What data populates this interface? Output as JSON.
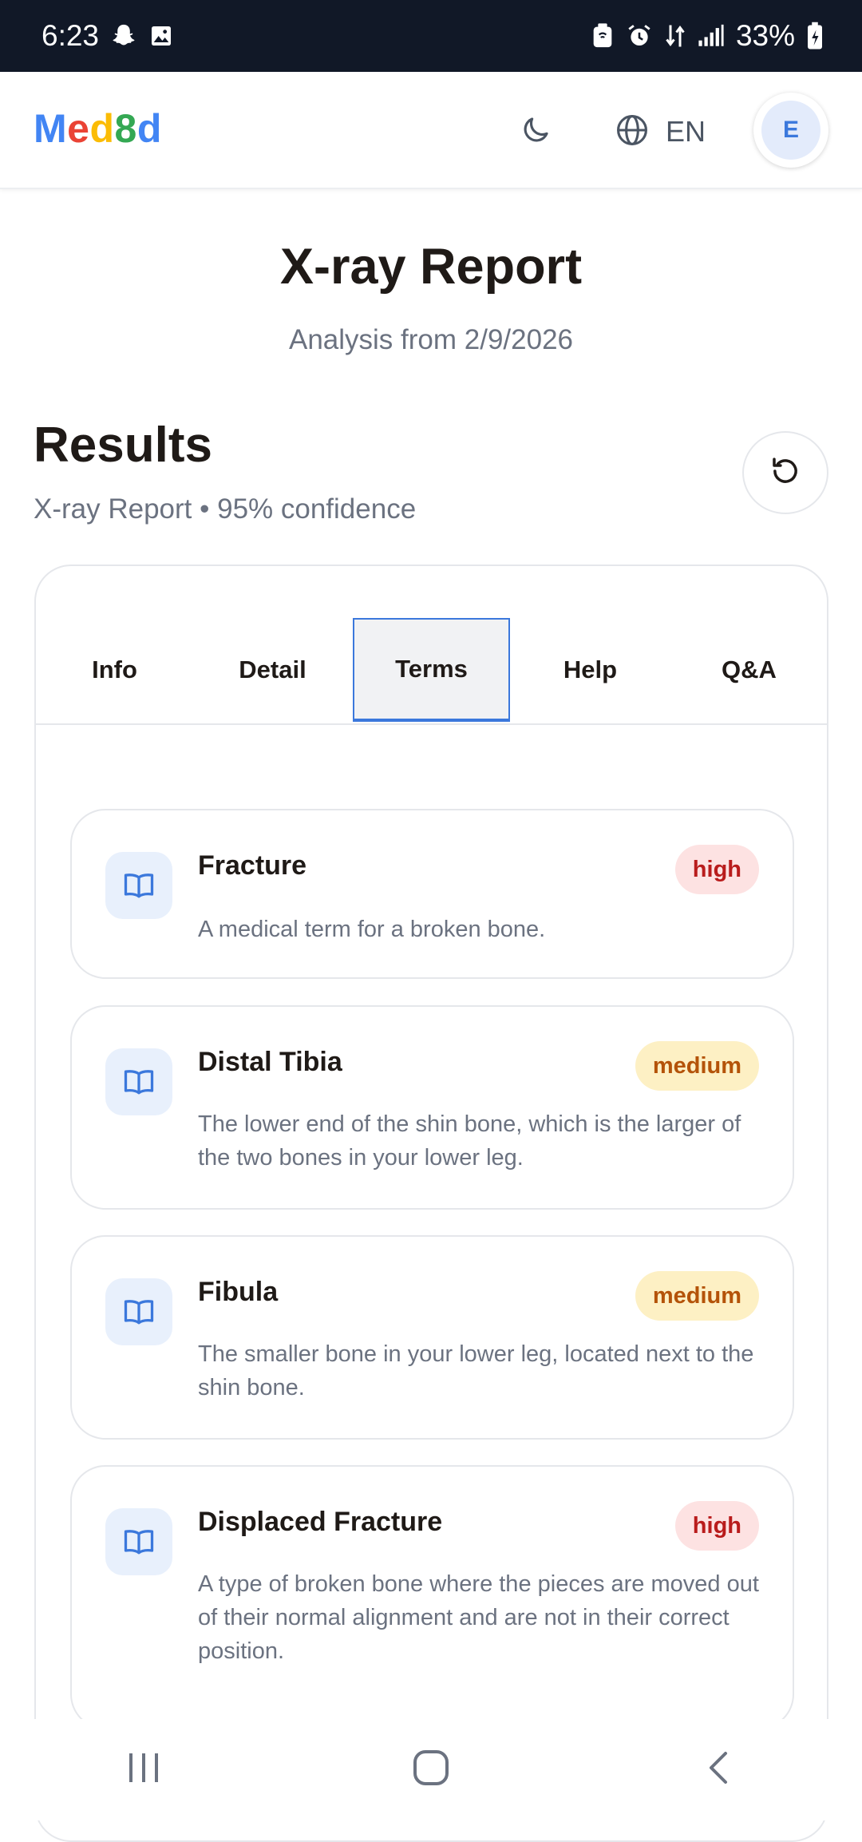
{
  "status_bar": {
    "time": "6:23",
    "battery": "33%",
    "left_icons": [
      "snapchat-icon",
      "gallery-icon"
    ],
    "right_icons": [
      "nfc-icon",
      "alarm-icon",
      "data-arrows-icon",
      "signal-icon",
      "battery-charging-icon"
    ]
  },
  "header": {
    "logo_letters": [
      {
        "char": "M",
        "color": "#4285F4"
      },
      {
        "char": "e",
        "color": "#EA4335"
      },
      {
        "char": "d",
        "color": "#FBBC05"
      },
      {
        "char": "8",
        "color": "#34A853"
      },
      {
        "char": "d",
        "color": "#4285F4"
      }
    ],
    "language": "EN",
    "avatar_initial": "E"
  },
  "page": {
    "title": "X-ray Report",
    "subtitle": "Analysis from 2/9/2026"
  },
  "results": {
    "heading": "Results",
    "meta": "X-ray Report • 95% confidence"
  },
  "tabs": [
    {
      "label": "Info",
      "active": false
    },
    {
      "label": "Detail",
      "active": false
    },
    {
      "label": "Terms",
      "active": true
    },
    {
      "label": "Help",
      "active": false
    },
    {
      "label": "Q&A",
      "active": false
    }
  ],
  "terms": [
    {
      "title": "Fracture",
      "badge": "high",
      "description": "A medical term for a broken bone."
    },
    {
      "title": "Distal Tibia",
      "badge": "medium",
      "description": "The lower end of the shin bone, which is the larger of the two bones in your lower leg."
    },
    {
      "title": "Fibula",
      "badge": "medium",
      "description": "The smaller bone in your lower leg, located next to the shin bone."
    },
    {
      "title": "Displaced Fracture",
      "badge": "high",
      "description": "A type of broken bone where the pieces are moved out of their normal alignment and are not in their correct position."
    }
  ],
  "colors": {
    "accent": "#3b78dc",
    "badge_high_bg": "#fde2e2",
    "badge_high_text": "#b91c1c",
    "badge_medium_bg": "#fdf0c4",
    "badge_medium_text": "#b45309",
    "status_bar_bg": "#111827"
  }
}
